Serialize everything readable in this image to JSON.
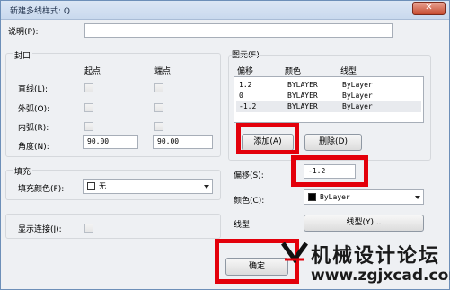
{
  "window": {
    "title": "新建多线样式: Q",
    "close_glyph": "✕"
  },
  "description": {
    "label": "说明(P):",
    "value": ""
  },
  "caps": {
    "section_label": "封口",
    "col_start": "起点",
    "col_end": "端点",
    "rows": [
      {
        "label": "直线(L):"
      },
      {
        "label": "外弧(O):"
      },
      {
        "label": "内弧(R):"
      }
    ],
    "angle": {
      "label": "角度(N):",
      "start_value": "90.00",
      "end_value": "90.00"
    }
  },
  "fill": {
    "section_label": "填充",
    "color_label": "填充颜色(F):",
    "color_value": "无"
  },
  "show_joints": {
    "label": "显示连接(J):"
  },
  "elements": {
    "section_label": "图元(E)",
    "headers": {
      "offset": "偏移",
      "color": "颜色",
      "linetype": "线型"
    },
    "rows": [
      {
        "offset": "1.2",
        "color": "BYLAYER",
        "linetype": "ByLayer"
      },
      {
        "offset": "0",
        "color": "BYLAYER",
        "linetype": "ByLayer"
      },
      {
        "offset": "-1.2",
        "color": "BYLAYER",
        "linetype": "ByLayer"
      }
    ],
    "add_label": "添加(A)",
    "delete_label": "删除(D)",
    "offset_label": "偏移(S):",
    "offset_value": "-1.2",
    "color_label": "颜色(C):",
    "color_value": "ByLayer",
    "linetype_label": "线型:",
    "linetype_button": "线型(Y)..."
  },
  "ok_label": "确定",
  "watermark": {
    "text_cn": "机械设计论坛",
    "url": "www.zgjxcad.com"
  },
  "colors": {
    "highlight": "#e3000b",
    "swatch_black": "#000000",
    "swatch_white": "#ffffff"
  }
}
